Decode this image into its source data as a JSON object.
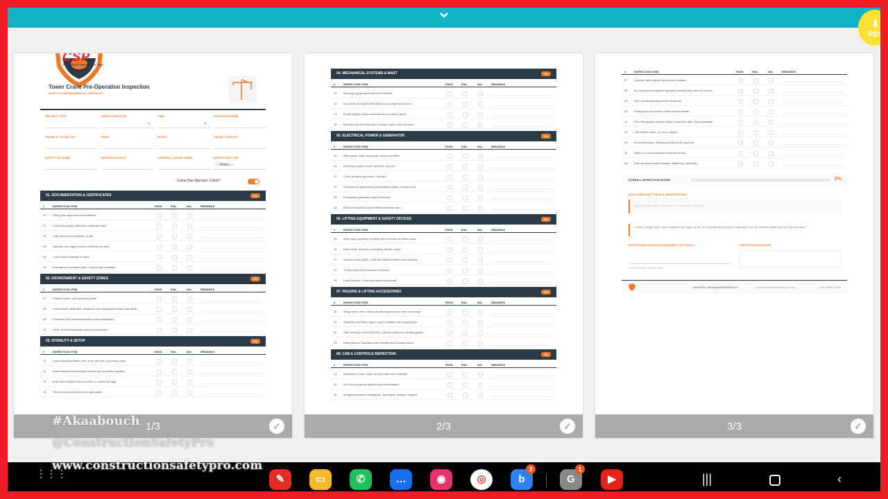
{
  "pdf_label": "PDF",
  "page1": {
    "brand": "CSP",
    "brand_sub": "CONSTRUCTION SAFETY PRO",
    "title": "Tower Crane Pre-Operation Inspection",
    "subtitle": "SAFETY & ENVIRONMENTAL CHECKLIST",
    "fields": [
      "PROJECT / SITE",
      "INSPECTION DATE",
      "TIME",
      "OPERATOR NAME",
      "CRANE ID / PLANT NO",
      "MAKE",
      "MODEL",
      "CRANE CAPACITY",
      "INSPECTOR NAME",
      "INSPECTOR TITLE",
      "COMPANY (CRANE USER)",
      "INSPECTION TYPE"
    ],
    "select_label": "— Select —",
    "cabin_label": "Crane Has Operator Cabin?",
    "page_num": "1/3"
  },
  "page2": {
    "page_num": "2/3"
  },
  "page3": {
    "score_label": "OVERALL INSPECTION SCORE",
    "score_value": "0%",
    "noncompliant": "NON-COMPLIANT ITEMS & OBSERVATIONS",
    "noncompliant_placeholder": "Note any failed items, hazards, or maintenance required...",
    "declaration": "I hereby declare that I have inspected the crane as per the checklist above prior to operation, and all recorded details are true and accurate *",
    "sup_label": "SUPERVISOR ACKNOWLEDGEMENT (OPTIONAL)",
    "op_sig_label": "OPERATOR SIGNATURE",
    "sup_sig_label": "SUPERVISOR SIGNATURE",
    "created": "Created by: Mustapha AKAABOUCH",
    "site": "www.constructionsafetypro.com",
    "tool": "CSP Safety Tools",
    "page_num": "3/3"
  },
  "col_headers": {
    "num": "#",
    "item": "INSPECTION ITEM",
    "pass": "PASS",
    "fail": "FAIL",
    "na": "N/A",
    "remarks": "REMARKS"
  },
  "sections_p1": [
    {
      "title": "01. DOCUMENTATION & CERTIFICATES",
      "pct": "0%",
      "items": [
        [
          "01",
          "Lifting plan approved and available"
        ],
        [
          "02",
          "Crane third-party calibration certificate valid"
        ],
        [
          "03",
          "Valid insurance certificate on site"
        ],
        [
          "04",
          "Operator and rigger license/certifications valid"
        ],
        [
          "05",
          "Load charts available in cabin"
        ],
        [
          "06",
          "Emergency evacuation plan / rescue plan available"
        ]
      ]
    },
    {
      "title": "02. ENVIRONMENT & SAFETY ZONES",
      "pct": "0%",
      "items": [
        [
          "07",
          "Weather within safe operating limits"
        ],
        [
          "08",
          "Anemometer calibrated, functional, and wind speed within safe limits"
        ],
        [
          "09",
          "Exclusion zone barricaded with caution tape/signs"
        ],
        [
          "10",
          "Clear of overhead power lines and obstacles"
        ]
      ]
    },
    {
      "title": "03. STABILITY & SETUP",
      "pct": "0%",
      "items": [
        [
          "11",
          "Crane base/foundation firm, level, and free of ponded water"
        ],
        [
          "12",
          "Base ballast/counterweights secure and in correct quantity"
        ],
        [
          "13",
          "Mast bolts and pins secured with no visible damage"
        ],
        [
          "14",
          "Tie-ins to structure secure (if applicable)"
        ]
      ]
    }
  ],
  "sections_p2": [
    {
      "title": "04. MECHANICAL SYSTEMS & MAST",
      "pct": "0%",
      "items": [
        [
          "15",
          "Slewing ring greased and free of debris"
        ],
        [
          "16",
          "No visible oil or gear fluid leaks on slewing/hoist motors"
        ],
        [
          "17",
          "Power supply cables unwinded and condition good"
        ],
        [
          "18",
          "Mast and jib structure free of cracks, dents, and corrosion"
        ]
      ]
    },
    {
      "title": "05. ELECTRICAL POWER & GENERATOR",
      "pct": "0%",
      "items": [
        [
          "19",
          "Main power cable and plugs in good condition"
        ],
        [
          "20",
          "Electrical panels closed, secured, and dry"
        ],
        [
          "21",
          "Crane properly grounded / earthed"
        ],
        [
          "22",
          "Generator (if applicable) fueled without leaks, exhaust clear"
        ],
        [
          "23",
          "Emergency generator stops functional"
        ],
        [
          "24",
          "Periodic inspection by certified electrician valid"
        ]
      ]
    },
    {
      "title": "06. LIFTING EQUIPMENT & SAFETY DEVICES",
      "pct": "0%",
      "items": [
        [
          "25",
          "Wire ropes spooling smoothly with no kinks or broken wires"
        ],
        [
          "26",
          "Hook block, sheaves, and safety latches intact"
        ],
        [
          "27",
          "Anti-two block (A2B) / load limit switches tested and working"
        ],
        [
          "28",
          "Trolley travel limit switches functional"
        ],
        [
          "29",
          "Load Moment / Overload system functional"
        ]
      ]
    },
    {
      "title": "07. RIGGING & LIFTING ACCESSORIES",
      "pct": "0%",
      "items": [
        [
          "30",
          "Slings (web, wire, chain) visually inspected and free of damage"
        ],
        [
          "31",
          "Shackles and lifting rings in good condition with original pins"
        ],
        [
          "32",
          "Safe Working Load (SWL/WLL) clearly marked on all lifting gears"
        ],
        [
          "33",
          "Lifting beams / spreader bars certified and visually sound"
        ]
      ]
    },
    {
      "title": "08. CAB & CONTROLS INSPECTION",
      "pct": "0%",
      "items": [
        [
          "34",
          "Windshield clean, intact, and provides clear visibility"
        ],
        [
          "35",
          "All mirrors properly adjusted and undamaged"
        ],
        [
          "36",
          "All lights functional (headlights, work lights, beacon, hazard)"
        ]
      ]
    }
  ],
  "rows_p3": [
    [
      "37",
      "Operator seat adjusts and locks in position"
    ],
    [
      "38",
      "All controls and joysticks operate smoothly and return to neutral"
    ],
    [
      "39",
      "Horn / audio warning device functional"
    ],
    [
      "40",
      "Emergency stop button tested and functional"
    ],
    [
      "41",
      "Fire extinguisher present, within inspection date, and accessible"
    ],
    [
      "42",
      "Cab interior clean, no loose objects"
    ],
    [
      "43",
      "Air conditioning / heating operational (if required)"
    ],
    [
      "44",
      "Radio or communication device functional"
    ],
    [
      "45",
      "Safe access to cabin (ladders, platforms, handrails)"
    ]
  ],
  "watermark": {
    "line1": "#Akaabouch",
    "line2": "@ConstructionSafetyPro",
    "line3": "www.constructionsafetypro.com"
  },
  "badges": {
    "bixby": "3",
    "google": "1"
  },
  "colors": {
    "frame": "#ee1c25",
    "topbar": "#13b3c6",
    "section": "#2b3a47",
    "accent": "#ee7a2a"
  }
}
